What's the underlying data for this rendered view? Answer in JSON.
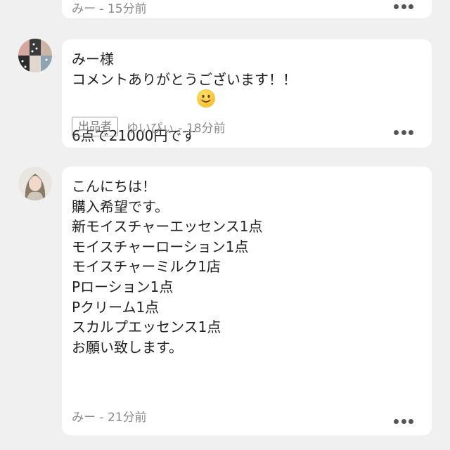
{
  "comments": [
    {
      "meta": "みー - 15分前"
    },
    {
      "lines": [
        "みー様",
        "コメントありがとうございます！！",
        "6点で21000円です"
      ],
      "emoji": "smiling-face",
      "badge": "出品者",
      "meta": "ゆいぴぃ - 18分前"
    },
    {
      "lines": [
        "こんにちは！",
        "購入希望です。",
        "",
        "新モイスチャーエッセンス1点",
        "モイスチャーローション1点",
        "モイスチャーミルク1店",
        "Pローション1点",
        "Pクリーム1点",
        "スカルプエッセンス1点",
        "",
        "お願い致します。"
      ],
      "meta": "みー - 21分前"
    }
  ],
  "icons": {
    "more": "more-dots-icon"
  }
}
